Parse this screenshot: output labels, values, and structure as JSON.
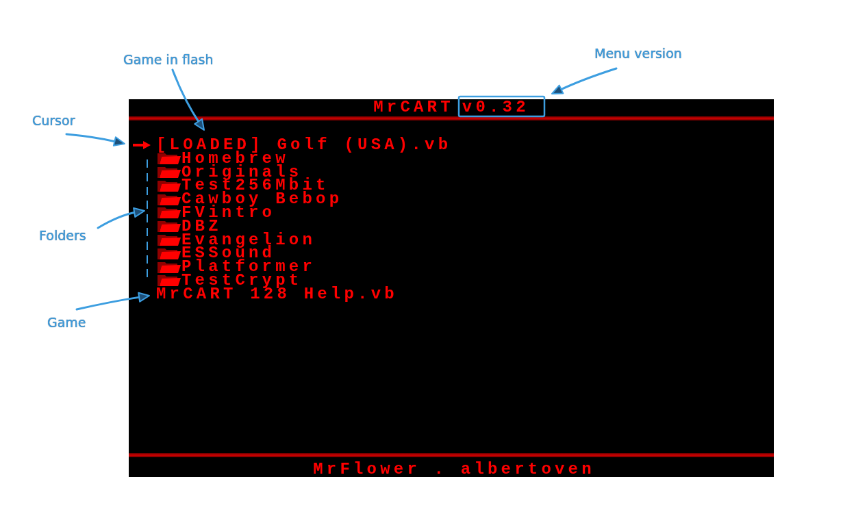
{
  "annotations": [
    {
      "label": "Game in flash"
    },
    {
      "label": "Menu version"
    },
    {
      "label": "Cursor"
    },
    {
      "label": "Folders"
    },
    {
      "label": "Game"
    }
  ],
  "screen": {
    "title": "MrCART",
    "version": "v0.32",
    "entries": [
      {
        "kind": "game",
        "label": "[LOADED] Golf (USA).vb",
        "selected": true
      },
      {
        "kind": "folder",
        "label": "Homebrew",
        "selected": false
      },
      {
        "kind": "folder",
        "label": "Originals",
        "selected": false
      },
      {
        "kind": "folder",
        "label": "Test256Mbit",
        "selected": false
      },
      {
        "kind": "folder",
        "label": "Cawboy Bebop",
        "selected": false
      },
      {
        "kind": "folder",
        "label": "FVintro",
        "selected": false
      },
      {
        "kind": "folder",
        "label": "DBZ",
        "selected": false
      },
      {
        "kind": "folder",
        "label": "Evangelion",
        "selected": false
      },
      {
        "kind": "folder",
        "label": "ESSound",
        "selected": false
      },
      {
        "kind": "folder",
        "label": "Platformer",
        "selected": false
      },
      {
        "kind": "folder",
        "label": "TestCrypt",
        "selected": false
      },
      {
        "kind": "game",
        "label": "MrCART 128 Help.vb",
        "selected": false
      }
    ],
    "footer": "MrFlower . albertoven"
  }
}
